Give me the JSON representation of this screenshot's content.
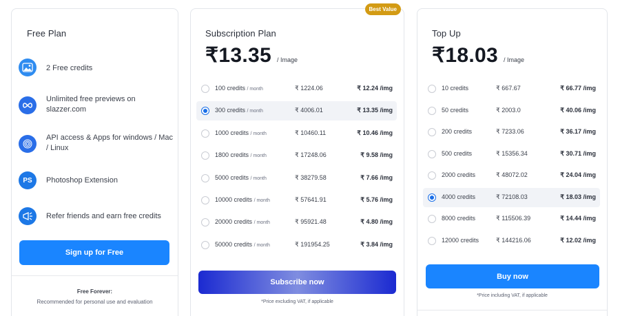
{
  "free_plan": {
    "title": "Free Plan",
    "features": [
      {
        "icon": "image-icon",
        "text": "2 Free credits"
      },
      {
        "icon": "infinity-icon",
        "text": "Unlimited free previews on slazzer.com"
      },
      {
        "icon": "fingerprint-icon",
        "text": "API access & Apps for windows / Mac / Linux"
      },
      {
        "icon": "photoshop-icon",
        "text": "Photoshop Extension",
        "glyph": "PS"
      },
      {
        "icon": "megaphone-icon",
        "text": "Refer friends and earn free credits"
      }
    ],
    "button_label": "Sign up for Free",
    "footer_title": "Free Forever:",
    "footer_text": "Recommended for personal use and evaluation"
  },
  "subscription_plan": {
    "title": "Subscription Plan",
    "badge": "Best Value",
    "price": "₹13.35",
    "per": "/ Image",
    "rows": [
      {
        "credits": "100 credits",
        "period": "/ month",
        "total": "₹ 1224.06",
        "per_img": "₹ 12.24 /img",
        "selected": false
      },
      {
        "credits": "300 credits",
        "period": "/ month",
        "total": "₹ 4006.01",
        "per_img": "₹ 13.35 /img",
        "selected": true
      },
      {
        "credits": "1000 credits",
        "period": "/ month",
        "total": "₹ 10460.11",
        "per_img": "₹ 10.46 /img",
        "selected": false
      },
      {
        "credits": "1800 credits",
        "period": "/ month",
        "total": "₹ 17248.06",
        "per_img": "₹ 9.58 /img",
        "selected": false
      },
      {
        "credits": "5000 credits",
        "period": "/ month",
        "total": "₹ 38279.58",
        "per_img": "₹ 7.66 /img",
        "selected": false
      },
      {
        "credits": "10000 credits",
        "period": "/ month",
        "total": "₹ 57641.91",
        "per_img": "₹ 5.76 /img",
        "selected": false
      },
      {
        "credits": "20000 credits",
        "period": "/ month",
        "total": "₹ 95921.48",
        "per_img": "₹ 4.80 /img",
        "selected": false
      },
      {
        "credits": "50000 credits",
        "period": "/ month",
        "total": "₹ 191954.25",
        "per_img": "₹ 3.84 /img",
        "selected": false
      }
    ],
    "button_label": "Subscribe now",
    "note": "*Price excluding VAT, if applicable"
  },
  "top_up": {
    "title": "Top Up",
    "price": "₹18.03",
    "per": "/ Image",
    "rows": [
      {
        "credits": "10 credits",
        "total": "₹ 667.67",
        "per_img": "₹ 66.77 /img",
        "selected": false
      },
      {
        "credits": "50 credits",
        "total": "₹ 2003.0",
        "per_img": "₹ 40.06 /img",
        "selected": false
      },
      {
        "credits": "200 credits",
        "total": "₹ 7233.06",
        "per_img": "₹ 36.17 /img",
        "selected": false
      },
      {
        "credits": "500 credits",
        "total": "₹ 15356.34",
        "per_img": "₹ 30.71 /img",
        "selected": false
      },
      {
        "credits": "2000 credits",
        "total": "₹ 48072.02",
        "per_img": "₹ 24.04 /img",
        "selected": false
      },
      {
        "credits": "4000 credits",
        "total": "₹ 72108.03",
        "per_img": "₹ 18.03 /img",
        "selected": true
      },
      {
        "credits": "8000 credits",
        "total": "₹ 115506.39",
        "per_img": "₹ 14.44 /img",
        "selected": false
      },
      {
        "credits": "12000 credits",
        "total": "₹ 144216.06",
        "per_img": "₹ 12.02 /img",
        "selected": false
      }
    ],
    "button_label": "Buy now",
    "note": "*Price including VAT, if applicable"
  },
  "colors": {
    "accent_blue": "#1a85ff",
    "badge_gold": "#d39b14",
    "radio_blue": "#1a6fe8",
    "gradient_dark": "#1b2ad1"
  }
}
